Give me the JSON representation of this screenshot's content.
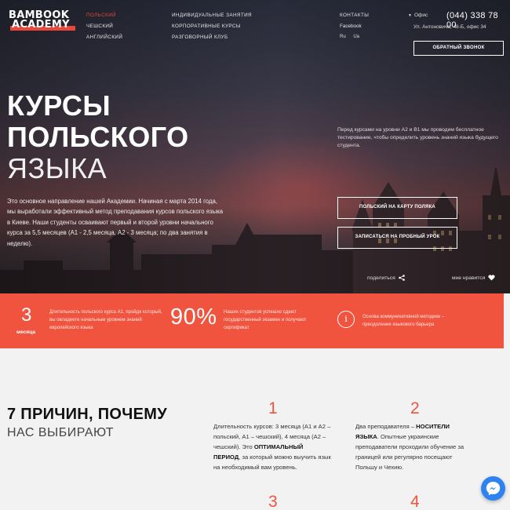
{
  "logo": {
    "line1": "BAMBOOK",
    "line2": "ACADEMY"
  },
  "nav": {
    "col1": [
      "ПОЛЬСКИЙ",
      "ЧЕШСКИЙ",
      "АНГЛИЙСКИЙ"
    ],
    "col2": [
      "ИНДИВИДУАЛЬНЫЕ ЗАНЯТИЯ",
      "КОРПОРАТИВНЫЕ КУРСЫ",
      "РАЗГОВОРНЫЙ КЛУБ"
    ],
    "col3": [
      "КОНТАКТЫ",
      "Facebook"
    ]
  },
  "languages": [
    "Ru",
    "Ua"
  ],
  "city": "Офис",
  "phone": "(044) 338 78 00",
  "address": "Ул. Антоновича, 48-Б, офис 34",
  "callback_label": "ОБРАТНЫЙ ЗВОНОК",
  "hero": {
    "title_line1": "КУРСЫ",
    "title_line2": "ПОЛЬСКОГО",
    "title_line3": "ЯЗЫКА",
    "description": "Это основное направление нашей Академии. Начиная с марта 2014 года, мы выработали эффективный метод преподавания курсов польского языка в Киеве. Наши студенты осваивают первый и второй уровни начального курса за 5,5 месяцев (А1 - 2,5 месяца, А2 - 3 месяца; по два занятия в неделю).",
    "test_note": "Перед курсами на уровни А2 и В1 мы проводим бесплатное тестирование, чтобы определить уровень знаний языка будущего студента.",
    "btn_card": "ПОЛЬСКИЙ НА КАРТУ ПОЛЯКА",
    "btn_trial": "ЗАПИСАТЬСЯ НА ПРОБНЫЙ УРОК",
    "share": "поделиться",
    "like": "мне нравится"
  },
  "stats": {
    "duration_value": "3",
    "duration_unit": "месяца",
    "duration_text": "Длительность польского курса А1, пройдя который, вы овладеете начальным уровнем знаний европейского языка",
    "percent_value": "90%",
    "percent_text": "Наших студентов успешно сдают государственный экзамен и получают сертификат",
    "method_text": "Основа коммуникативной методики – преодоление языкового барьера"
  },
  "reasons": {
    "title_bold": "7 ПРИЧИН, ПОЧЕМУ",
    "title_sub": "НАС ВЫБИРАЮТ",
    "items": [
      {
        "num": "1",
        "text_a": "Длительность курсов: 3 месяца (А1 и А2 – польский, А1 – чешский), 4 месяца (А2 – чешский). Это ",
        "bold": "ОПТИМАЛЬНЫЙ ПЕРИОД",
        "text_b": ", за который можно выучить язык на необходимый вам уровень."
      },
      {
        "num": "2",
        "text_a": "Два преподавателя – ",
        "bold": "НОСИТЕЛИ ЯЗЫКА",
        "text_b": ". Опытные украинские преподаватели проходили обучение за границей или регулярно посещают Польшу и Чехию."
      },
      {
        "num": "3"
      },
      {
        "num": "4"
      }
    ]
  },
  "colors": {
    "accent": "#f0543f",
    "messenger": "#2e83ef"
  }
}
